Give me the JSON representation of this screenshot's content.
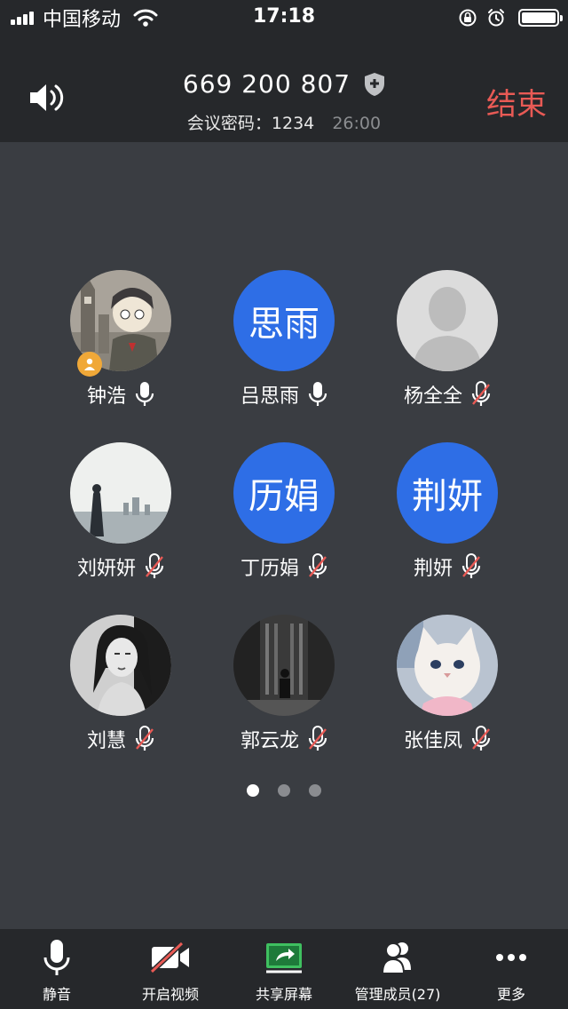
{
  "status_bar": {
    "carrier": "中国移动",
    "time": "17:18"
  },
  "header": {
    "meeting_id": "669 200 807",
    "password_label": "会议密码：",
    "password": "1234",
    "duration": "26:00",
    "end_label": "结束"
  },
  "participants": [
    {
      "name": "钟浩",
      "avatar_type": "photo",
      "mic": "on",
      "host": true
    },
    {
      "name": "吕思雨",
      "avatar_type": "text",
      "avatar_text": "思雨",
      "mic": "on"
    },
    {
      "name": "杨全全",
      "avatar_type": "default",
      "mic": "muted"
    },
    {
      "name": "刘妍妍",
      "avatar_type": "photo",
      "mic": "muted"
    },
    {
      "name": "丁历娟",
      "avatar_type": "text",
      "avatar_text": "历娟",
      "mic": "muted"
    },
    {
      "name": "荆妍",
      "avatar_type": "text",
      "avatar_text": "荆妍",
      "mic": "muted"
    },
    {
      "name": "刘慧",
      "avatar_type": "photo",
      "mic": "muted"
    },
    {
      "name": "郭云龙",
      "avatar_type": "photo",
      "mic": "muted"
    },
    {
      "name": "张佳凤",
      "avatar_type": "photo",
      "mic": "muted"
    }
  ],
  "pager": {
    "current": 1,
    "total": 3
  },
  "toolbar": {
    "mute_label": "静音",
    "video_label": "开启视频",
    "share_label": "共享屏幕",
    "members_label": "管理成员(27)",
    "more_label": "更多"
  },
  "colors": {
    "accent_blue": "#2e6ee6",
    "end_red": "#e85a55",
    "share_green": "#3fc060",
    "host_badge": "#f0a838",
    "background": "#3a3d42",
    "bar": "#26282b"
  }
}
